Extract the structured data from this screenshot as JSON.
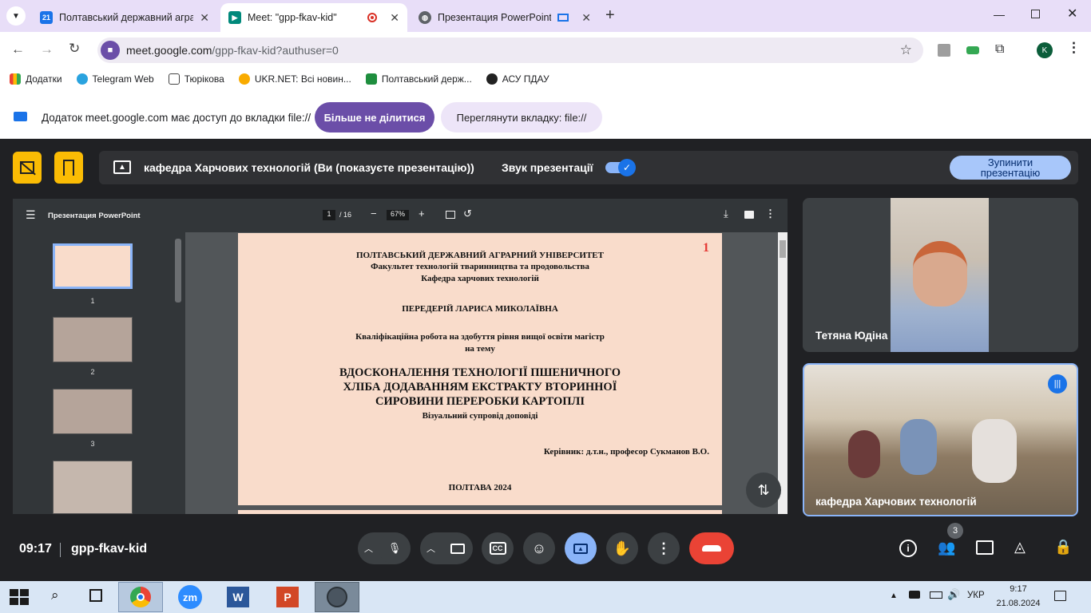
{
  "browser": {
    "tabs": [
      {
        "title": "Полтавський державний агра",
        "favicon_text": "21",
        "favicon_color": "#1a73e8"
      },
      {
        "title": "Meet: \"gpp-fkav-kid\"",
        "favicon_color": "#00897b"
      },
      {
        "title": "Презентация PowerPoint",
        "favicon_color": "#5f6368"
      }
    ],
    "new_tab": "+",
    "url_host": "meet.google.com",
    "url_path": "/gpp-fkav-kid?authuser=0",
    "profile_initial": "K",
    "bookmarks": [
      "Додатки",
      "Telegram Web",
      "Тюрікова",
      "UKR.NET: Всі новин...",
      "Полтавський держ...",
      "АСУ ПДАУ"
    ]
  },
  "share_notice": {
    "text": "Додаток meet.google.com має доступ до вкладки file://",
    "stop_label": "Більше не ділитися",
    "view_label": "Переглянути вкладку: file://"
  },
  "present_bar": {
    "title": "кафедра Харчових технологій (Ви (показуєте презентацію))",
    "audio_label": "Звук презентації",
    "stop_label_1": "Зупинити",
    "stop_label_2": "презентацію"
  },
  "pdf": {
    "title": "Презентация PowerPoint",
    "page": "1",
    "total": "/ 16",
    "zoom": "67%",
    "thumb_numbers": [
      "1",
      "2",
      "3"
    ]
  },
  "slide": {
    "number": "1",
    "univ": "ПОЛТАВСЬКИЙ ДЕРЖАВНИЙ АГРАРНИЙ УНІВЕРСИТЕТ",
    "faculty": "Факультет технологій тваринництва та продовольства",
    "dept": "Кафедра харчових технологій",
    "author": "ПЕРЕДЕРІЙ ЛАРИСА МИКОЛАЇВНА",
    "work1": "Кваліфікаційна робота на здобуття рівня вищої освіти магістр",
    "work2": "на тему",
    "topic1": "ВДОСКОНАЛЕННЯ ТЕХНОЛОГІЇ ПШЕНИЧНОГО",
    "topic2": "ХЛІБА ДОДАВАННЯМ ЕКСТРАКТУ ВТОРИННОЇ",
    "topic3": "СИРОВИНИ ПЕРЕРОБКИ КАРТОПЛІ",
    "visual": "Візуальний супровід доповіді",
    "supervisor": "Керівник: д.т.н., професор Сукманов В.О.",
    "city": "ПОЛТАВА 2024"
  },
  "participants": [
    {
      "name": "Тетяна Юдіна"
    },
    {
      "name": "кафедра Харчових технологій"
    }
  ],
  "meeting": {
    "time": "09:17",
    "code": "gpp-fkav-kid",
    "participant_count": "3"
  },
  "taskbar": {
    "lang": "УКР",
    "clock_time": "9:17",
    "clock_date": "21.08.2024",
    "zm_label": "zm"
  }
}
